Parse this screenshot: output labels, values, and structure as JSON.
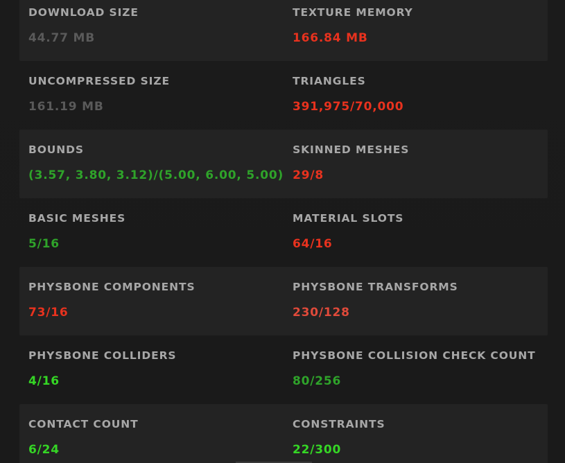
{
  "colors": {
    "label": "#a7a7a7",
    "gray_value": "#5a5a5a",
    "red_value": "#e8321e",
    "soft_red_value": "#e04a3a",
    "green_value": "#2fa32a",
    "bright_green_value": "#35d625",
    "background": "#1a1a1a",
    "alt_row": "#232323"
  },
  "stats": [
    {
      "left": {
        "label": "DOWNLOAD SIZE",
        "value": "44.77 MB",
        "color": "#5a5a5a"
      },
      "right": {
        "label": "TEXTURE MEMORY",
        "value": "166.84 MB",
        "color": "#e8321e"
      }
    },
    {
      "left": {
        "label": "UNCOMPRESSED SIZE",
        "value": "161.19 MB",
        "color": "#5a5a5a"
      },
      "right": {
        "label": "TRIANGLES",
        "value": "391,975/70,000",
        "color": "#e8321e"
      }
    },
    {
      "left": {
        "label": "BOUNDS",
        "value": "(3.57, 3.80, 3.12)/(5.00, 6.00, 5.00)",
        "color": "#2fa32a"
      },
      "right": {
        "label": "SKINNED MESHES",
        "value": "29/8",
        "color": "#e8321e"
      }
    },
    {
      "left": {
        "label": "BASIC MESHES",
        "value": "5/16",
        "color": "#2fa32a"
      },
      "right": {
        "label": "MATERIAL SLOTS",
        "value": "64/16",
        "color": "#e8321e"
      }
    },
    {
      "left": {
        "label": "PHYSBONE COMPONENTS",
        "value": "73/16",
        "color": "#e8321e"
      },
      "right": {
        "label": "PHYSBONE TRANSFORMS",
        "value": "230/128",
        "color": "#e04a3a"
      }
    },
    {
      "left": {
        "label": "PHYSBONE COLLIDERS",
        "value": "4/16",
        "color": "#35d625"
      },
      "right": {
        "label": "PHYSBONE COLLISION CHECK COUNT",
        "value": "80/256",
        "color": "#2fa32a"
      }
    },
    {
      "left": {
        "label": "CONTACT COUNT",
        "value": "6/24",
        "color": "#35d625"
      },
      "right": {
        "label": "CONSTRAINTS",
        "value": "22/300",
        "color": "#35d625"
      }
    }
  ]
}
